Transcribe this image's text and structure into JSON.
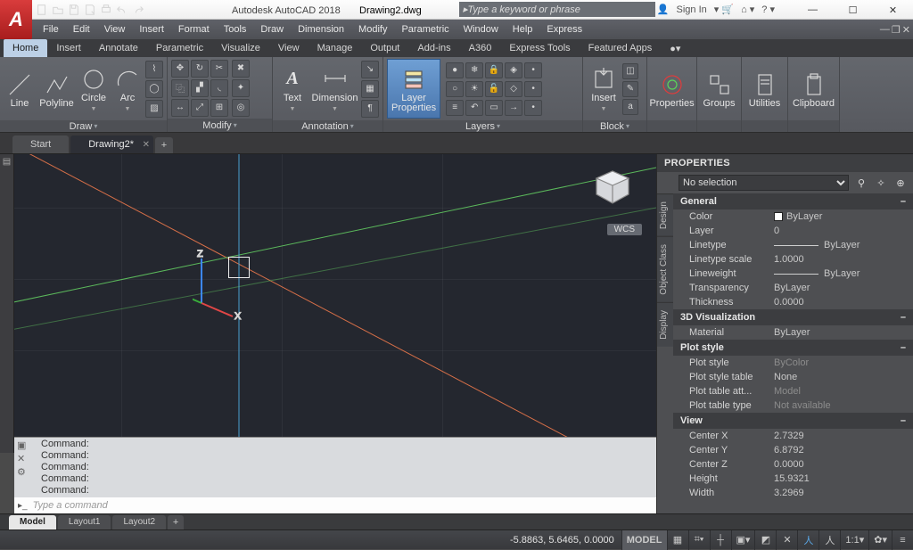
{
  "title": {
    "app": "Autodesk AutoCAD 2018",
    "file": "Drawing2.dwg"
  },
  "search_placeholder": "Type a keyword or phrase",
  "signin": "Sign In",
  "menu": [
    "File",
    "Edit",
    "View",
    "Insert",
    "Format",
    "Tools",
    "Draw",
    "Dimension",
    "Modify",
    "Parametric",
    "Window",
    "Help",
    "Express"
  ],
  "ribtabs": [
    "Home",
    "Insert",
    "Annotate",
    "Parametric",
    "Visualize",
    "View",
    "Manage",
    "Output",
    "Add-ins",
    "A360",
    "Express Tools",
    "Featured Apps"
  ],
  "ribtabs_active": 0,
  "ribbon": {
    "draw": {
      "label": "Draw",
      "line": "Line",
      "polyline": "Polyline",
      "circle": "Circle",
      "arc": "Arc"
    },
    "modify": {
      "label": "Modify"
    },
    "annotation": {
      "label": "Annotation",
      "text": "Text",
      "dimension": "Dimension"
    },
    "layers": {
      "label": "Layers",
      "layerprops": "Layer\nProperties"
    },
    "block": {
      "label": "Block",
      "insert": "Insert"
    },
    "properties": {
      "label": "Properties"
    },
    "groups": {
      "label": "Groups"
    },
    "utilities": {
      "label": "Utilities"
    },
    "clipboard": {
      "label": "Clipboard"
    }
  },
  "doctabs": {
    "items": [
      "Start",
      "Drawing2*"
    ],
    "active": 1
  },
  "wcs_badge": "WCS",
  "cmd": {
    "lines": [
      "Command:",
      "Command:",
      "Command:",
      "Command:",
      "Command:"
    ],
    "placeholder": "Type a command"
  },
  "props": {
    "title": "PROPERTIES",
    "selection": "No selection",
    "tabs": [
      "Design",
      "Object Class",
      "Display"
    ],
    "cats": [
      {
        "name": "General",
        "rows": [
          {
            "k": "Color",
            "v": "ByLayer",
            "chip": true
          },
          {
            "k": "Layer",
            "v": "0"
          },
          {
            "k": "Linetype",
            "v": "ByLayer",
            "line": true
          },
          {
            "k": "Linetype scale",
            "v": "1.0000"
          },
          {
            "k": "Lineweight",
            "v": "ByLayer",
            "line": true
          },
          {
            "k": "Transparency",
            "v": "ByLayer"
          },
          {
            "k": "Thickness",
            "v": "0.0000"
          }
        ]
      },
      {
        "name": "3D Visualization",
        "rows": [
          {
            "k": "Material",
            "v": "ByLayer"
          }
        ]
      },
      {
        "name": "Plot style",
        "rows": [
          {
            "k": "Plot style",
            "v": "ByColor",
            "dim": true
          },
          {
            "k": "Plot style table",
            "v": "None"
          },
          {
            "k": "Plot table att...",
            "v": "Model",
            "dim": true
          },
          {
            "k": "Plot table type",
            "v": "Not available",
            "dim": true
          }
        ]
      },
      {
        "name": "View",
        "rows": [
          {
            "k": "Center X",
            "v": "2.7329"
          },
          {
            "k": "Center Y",
            "v": "6.8792"
          },
          {
            "k": "Center Z",
            "v": "0.0000"
          },
          {
            "k": "Height",
            "v": "15.9321"
          },
          {
            "k": "Width",
            "v": "3.2969"
          }
        ]
      }
    ]
  },
  "layouts": {
    "items": [
      "Model",
      "Layout1",
      "Layout2"
    ],
    "active": 0
  },
  "status": {
    "coords": "-5.8863, 5.6465, 0.0000",
    "model": "MODEL",
    "scale": "1:1"
  }
}
